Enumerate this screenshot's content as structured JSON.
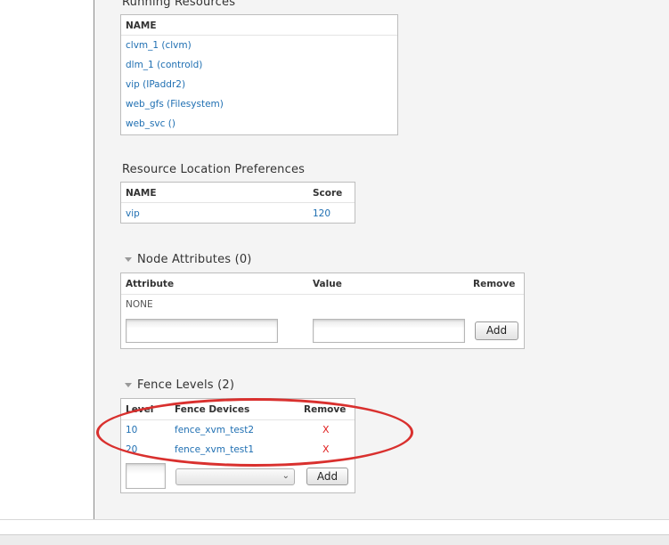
{
  "running_resources": {
    "title": "Running Resources",
    "header": "NAME",
    "items": [
      "clvm_1 (clvm)",
      "dlm_1 (controld)",
      "vip (IPaddr2)",
      "web_gfs (Filesystem)",
      "web_svc ()"
    ]
  },
  "location_prefs": {
    "title": "Resource Location Preferences",
    "headers": {
      "name": "NAME",
      "score": "Score"
    },
    "rows": [
      {
        "name": "vip",
        "score": "120"
      }
    ]
  },
  "node_attributes": {
    "title": "Node Attributes (0)",
    "headers": {
      "attribute": "Attribute",
      "value": "Value",
      "remove": "Remove"
    },
    "empty_text": "NONE",
    "add_label": "Add"
  },
  "fence_levels": {
    "title": "Fence Levels (2)",
    "headers": {
      "level": "Level",
      "devices": "Fence Devices",
      "remove": "Remove"
    },
    "rows": [
      {
        "level": "10",
        "device": "fence_xvm_test2",
        "remove": "X"
      },
      {
        "level": "20",
        "device": "fence_xvm_test1",
        "remove": "X"
      }
    ],
    "select_value": "",
    "add_label": "Add"
  },
  "colors": {
    "link": "#1f6fb2",
    "remove": "#e02020",
    "annotation": "#d9302e",
    "panel_bg": "#f4f4f4"
  },
  "icons": {
    "section_toggle": "chevron-down-icon"
  }
}
